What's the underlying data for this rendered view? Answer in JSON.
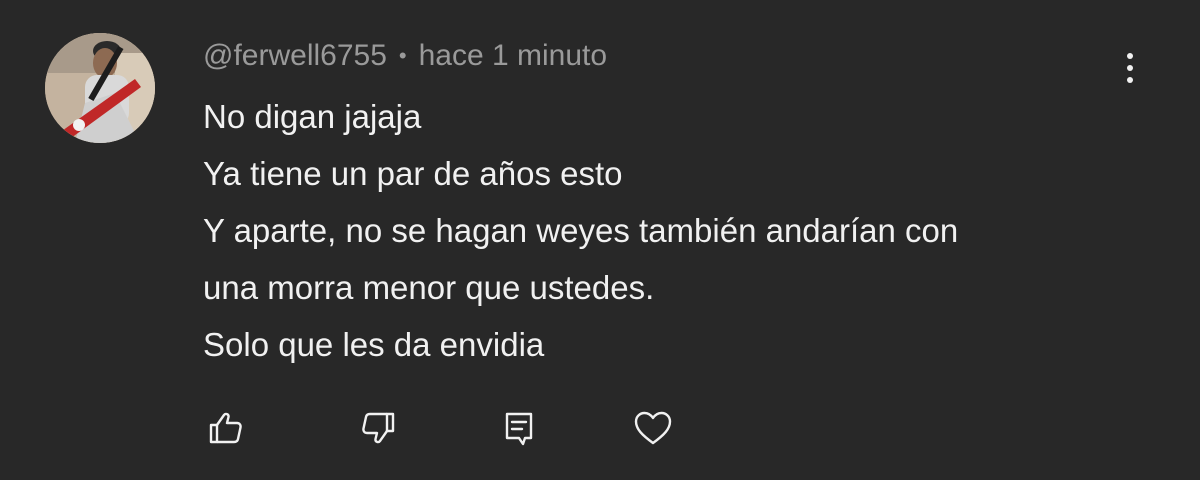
{
  "comment": {
    "author": "@ferwell6755",
    "separator": "•",
    "timestamp": "hace 1 minuto",
    "lines": [
      "No digan jajaja",
      "Ya tiene un par de años esto",
      "Y aparte, no se hagan weyes también andarían con",
      "una morra menor que ustedes.",
      "Solo que les da envidia"
    ]
  },
  "actions": {
    "like_icon": "thumbs-up-icon",
    "dislike_icon": "thumbs-down-icon",
    "reply_icon": "comment-reply-icon",
    "heart_icon": "heart-icon",
    "menu_icon": "more-vertical-icon"
  },
  "colors": {
    "background": "#282828",
    "text": "#f1f1f1",
    "meta": "#9a9a9a"
  }
}
